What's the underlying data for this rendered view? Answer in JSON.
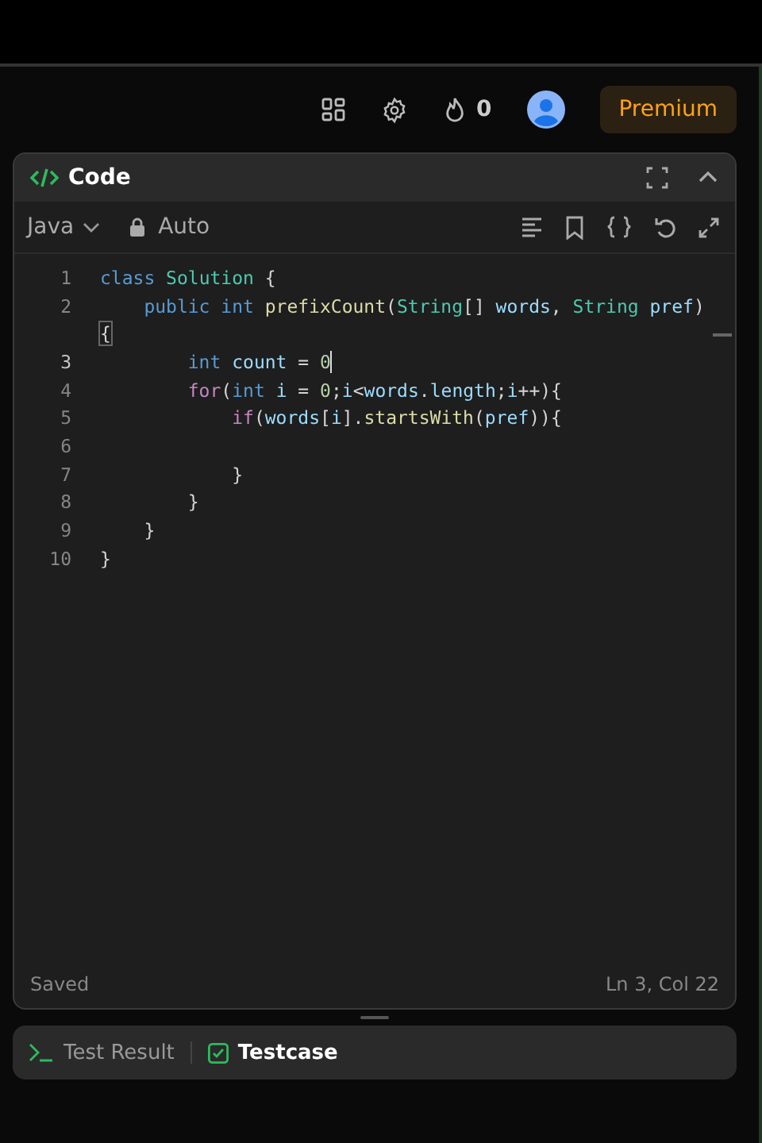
{
  "header": {
    "streak": "0",
    "premium": "Premium"
  },
  "panel": {
    "title": "Code",
    "language": "Java",
    "mode": "Auto"
  },
  "lines": [
    {
      "number": "1",
      "active": false,
      "tokens": [
        {
          "text": "class ",
          "kind": "keyword"
        },
        {
          "text": "Solution",
          "kind": "type"
        },
        {
          "text": " {",
          "kind": "plain"
        }
      ]
    },
    {
      "number": "2",
      "active": false,
      "tokens": [
        {
          "text": "    public int ",
          "kind": "keyword"
        },
        {
          "text": "prefixCount",
          "kind": "func"
        },
        {
          "text": "(",
          "kind": "plain"
        },
        {
          "text": "String",
          "kind": "type"
        },
        {
          "text": "[] ",
          "kind": "plain"
        },
        {
          "text": "words",
          "kind": "var"
        },
        {
          "text": ", ",
          "kind": "plain"
        },
        {
          "text": "String",
          "kind": "type"
        },
        {
          "text": " pref",
          "kind": "var"
        },
        {
          "text": ")",
          "kind": "plain"
        }
      ],
      "continuation": "{"
    },
    {
      "number": "3",
      "active": true,
      "tokens": [
        {
          "text": "        int ",
          "kind": "keyword"
        },
        {
          "text": "count",
          "kind": "var"
        },
        {
          "text": " = ",
          "kind": "plain"
        },
        {
          "text": "0",
          "kind": "number"
        }
      ]
    },
    {
      "number": "4",
      "active": false,
      "tokens": [
        {
          "text": "        for",
          "kind": "control"
        },
        {
          "text": "(",
          "kind": "plain"
        },
        {
          "text": "int ",
          "kind": "keyword"
        },
        {
          "text": "i",
          "kind": "var"
        },
        {
          "text": " = ",
          "kind": "plain"
        },
        {
          "text": "0",
          "kind": "number"
        },
        {
          "text": ";",
          "kind": "plain"
        },
        {
          "text": "i",
          "kind": "var"
        },
        {
          "text": "<",
          "kind": "plain"
        },
        {
          "text": "words",
          "kind": "var"
        },
        {
          "text": ".",
          "kind": "plain"
        },
        {
          "text": "length",
          "kind": "var"
        },
        {
          "text": ";",
          "kind": "plain"
        },
        {
          "text": "i",
          "kind": "var"
        },
        {
          "text": "++){",
          "kind": "plain"
        }
      ]
    },
    {
      "number": "5",
      "active": false,
      "tokens": [
        {
          "text": "            if",
          "kind": "control"
        },
        {
          "text": "(",
          "kind": "plain"
        },
        {
          "text": "words",
          "kind": "var"
        },
        {
          "text": "[",
          "kind": "plain"
        },
        {
          "text": "i",
          "kind": "var"
        },
        {
          "text": "].",
          "kind": "plain"
        },
        {
          "text": "startsWith",
          "kind": "func"
        },
        {
          "text": "(",
          "kind": "plain"
        },
        {
          "text": "pref",
          "kind": "var"
        },
        {
          "text": ")){",
          "kind": "plain"
        }
      ]
    },
    {
      "number": "6",
      "active": false
    },
    {
      "number": "7",
      "active": false,
      "tokens": [
        {
          "text": "            }",
          "kind": "plain"
        }
      ]
    },
    {
      "number": "8",
      "active": false,
      "tokens": [
        {
          "text": "        }",
          "kind": "plain"
        }
      ]
    },
    {
      "number": "9",
      "active": false,
      "tokens": [
        {
          "text": "    }",
          "kind": "plain"
        }
      ]
    },
    {
      "number": "10",
      "active": false,
      "tokens": [
        {
          "text": "}",
          "kind": "plain"
        }
      ]
    }
  ],
  "status": {
    "saved": "Saved",
    "position": "Ln 3, Col 22"
  },
  "tabs": [
    {
      "label": "Test Result",
      "kind": "terminal",
      "selected": false
    },
    {
      "label": "Testcase",
      "kind": "check",
      "selected": true
    }
  ]
}
